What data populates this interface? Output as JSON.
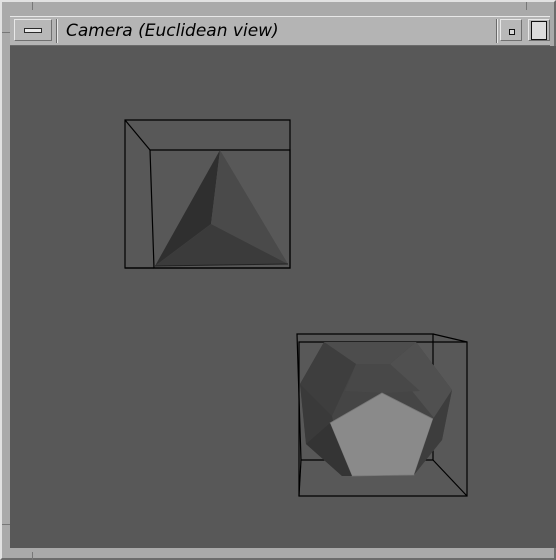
{
  "window": {
    "title": "Camera (Euclidean view)",
    "buttons": {
      "menu": "window-menu",
      "minimize": "minimize",
      "maximize": "maximize"
    }
  },
  "viewport": {
    "background": "#585858",
    "objects": [
      {
        "name": "tetrahedron",
        "bounding_box": "wireframe"
      },
      {
        "name": "dodecahedron",
        "bounding_box": "wireframe"
      }
    ]
  },
  "colors": {
    "frame": "#aaaaaa",
    "titlebar": "#b4b4b4",
    "viewport": "#585858",
    "face_light": "#8a8a8a",
    "face_mid": "#4a4a4a",
    "face_dark": "#2e2e2e",
    "wire": "#000000"
  }
}
